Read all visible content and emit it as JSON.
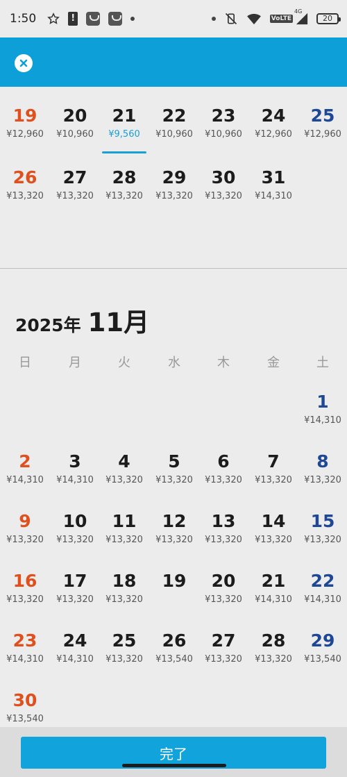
{
  "status": {
    "time": "1:50",
    "battery": "20",
    "network": "VoLTE",
    "generation": "4G"
  },
  "calendar": {
    "prev_weeks": [
      [
        {
          "day": "19",
          "price": "¥12,960",
          "kind": "sun"
        },
        {
          "day": "20",
          "price": "¥10,960"
        },
        {
          "day": "21",
          "price": "¥9,560",
          "selected": true
        },
        {
          "day": "22",
          "price": "¥10,960"
        },
        {
          "day": "23",
          "price": "¥10,960"
        },
        {
          "day": "24",
          "price": "¥12,960"
        },
        {
          "day": "25",
          "price": "¥12,960",
          "kind": "sat"
        }
      ],
      [
        {
          "day": "26",
          "price": "¥13,320",
          "kind": "sun"
        },
        {
          "day": "27",
          "price": "¥13,320"
        },
        {
          "day": "28",
          "price": "¥13,320"
        },
        {
          "day": "29",
          "price": "¥13,320"
        },
        {
          "day": "30",
          "price": "¥13,320"
        },
        {
          "day": "31",
          "price": "¥14,310"
        },
        null
      ]
    ],
    "month_header": {
      "year": "2025年",
      "month": "11月"
    },
    "weekdays": [
      "日",
      "月",
      "火",
      "水",
      "木",
      "金",
      "土"
    ],
    "weeks": [
      [
        null,
        null,
        null,
        null,
        null,
        null,
        {
          "day": "1",
          "price": "¥14,310",
          "kind": "sat"
        }
      ],
      [
        {
          "day": "2",
          "price": "¥14,310",
          "kind": "sun"
        },
        {
          "day": "3",
          "price": "¥14,310"
        },
        {
          "day": "4",
          "price": "¥13,320"
        },
        {
          "day": "5",
          "price": "¥13,320"
        },
        {
          "day": "6",
          "price": "¥13,320"
        },
        {
          "day": "7",
          "price": "¥13,320"
        },
        {
          "day": "8",
          "price": "¥13,320",
          "kind": "sat"
        }
      ],
      [
        {
          "day": "9",
          "price": "¥13,320",
          "kind": "sun"
        },
        {
          "day": "10",
          "price": "¥13,320"
        },
        {
          "day": "11",
          "price": "¥13,320"
        },
        {
          "day": "12",
          "price": "¥13,320"
        },
        {
          "day": "13",
          "price": "¥13,320"
        },
        {
          "day": "14",
          "price": "¥13,320"
        },
        {
          "day": "15",
          "price": "¥13,320",
          "kind": "sat"
        }
      ],
      [
        {
          "day": "16",
          "price": "¥13,320",
          "kind": "sun"
        },
        {
          "day": "17",
          "price": "¥13,320"
        },
        {
          "day": "18",
          "price": "¥13,320"
        },
        {
          "day": "19",
          "price": ""
        },
        {
          "day": "20",
          "price": "¥13,320"
        },
        {
          "day": "21",
          "price": "¥14,310"
        },
        {
          "day": "22",
          "price": "¥14,310",
          "kind": "sat"
        }
      ],
      [
        {
          "day": "23",
          "price": "¥14,310",
          "kind": "sun"
        },
        {
          "day": "24",
          "price": "¥14,310"
        },
        {
          "day": "25",
          "price": "¥13,320"
        },
        {
          "day": "26",
          "price": "¥13,540"
        },
        {
          "day": "27",
          "price": "¥13,320"
        },
        {
          "day": "28",
          "price": "¥13,320"
        },
        {
          "day": "29",
          "price": "¥13,540",
          "kind": "sat"
        }
      ],
      [
        {
          "day": "30",
          "price": "¥13,540",
          "kind": "sun"
        },
        null,
        null,
        null,
        null,
        null,
        null
      ]
    ]
  },
  "footer": {
    "done_label": "完了"
  },
  "colors": {
    "accent": "#0da0d8",
    "sunday": "#e0501e",
    "saturday": "#1e4896"
  }
}
